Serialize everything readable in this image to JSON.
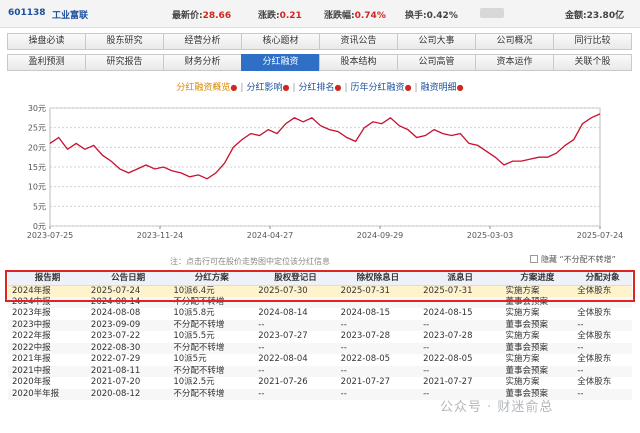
{
  "quote": {
    "code": "601138",
    "name": "工业富联",
    "latest_label": "最新价:",
    "latest_value": "28.66",
    "change_label": "涨跌:",
    "change_value": "0.21",
    "pct_label": "涨跌幅:",
    "pct_value": "0.74%",
    "turnover_label": "换手:",
    "turnover_value": "0.42%",
    "amount_label": "金额:",
    "amount_value": "23.80亿"
  },
  "nav_row1": [
    "操盘必读",
    "股东研究",
    "经营分析",
    "核心题材",
    "资讯公告",
    "公司大事",
    "公司概况",
    "同行比较"
  ],
  "nav_row2": [
    "盈利预测",
    "研究报告",
    "财务分析",
    "分红融资",
    "股本结构",
    "公司高管",
    "资本运作",
    "关联个股"
  ],
  "nav_active": "分红融资",
  "subtabs": [
    "分红融资概览",
    "分红影响",
    "分红排名",
    "历年分红融资",
    "融资明细"
  ],
  "chart_data": {
    "type": "line",
    "x_ticks": [
      "2023-07-25",
      "2023-11-24",
      "2024-04-27",
      "2024-09-29",
      "2025-03-03",
      "2025-07-24"
    ],
    "y_ticks": [
      "0元",
      "5元",
      "10元",
      "15元",
      "20元",
      "25元",
      "30元"
    ],
    "ylim": [
      0,
      30
    ],
    "series": [
      {
        "values": [
          21,
          22.5,
          19.5,
          21,
          19.5,
          20.5,
          18,
          16.5,
          14.5,
          13.5,
          14.5,
          15.5,
          14.5,
          15,
          14,
          13.5,
          12.5,
          13,
          12,
          13.5,
          16,
          20,
          22,
          23.5,
          23,
          24.5,
          23.5,
          26,
          27.5,
          26.5,
          27.5,
          25.5,
          24.5,
          24,
          22.5,
          21.5,
          25,
          26.5,
          26,
          27.5,
          25.5,
          24.5,
          22.5,
          23,
          24.5,
          23.5,
          23,
          23.5,
          21,
          20.5,
          19,
          17.5,
          15.5,
          16.5,
          16.5,
          17,
          17.5,
          17.5,
          18.5,
          20.5,
          22,
          26,
          27.5,
          28.5
        ]
      }
    ]
  },
  "hint": "注：点击行可在股价走势图中定位该分红信息",
  "hide_option": "隐藏 “不分配不转增”",
  "table": {
    "headers": [
      "报告期",
      "公告日期",
      "分红方案",
      "股权登记日",
      "除权除息日",
      "派息日",
      "方案进度",
      "分配对象"
    ],
    "rows": [
      [
        "2024年报",
        "2025-07-24",
        "10派6.4元",
        "2025-07-30",
        "2025-07-31",
        "2025-07-31",
        "实施方案",
        "全体股东"
      ],
      [
        "2024中报",
        "2024-08-14",
        "不分配不转增",
        "",
        "",
        "",
        "董事会预案",
        ""
      ],
      [
        "2023年报",
        "2024-08-08",
        "10派5.8元",
        "2024-08-14",
        "2024-08-15",
        "2024-08-15",
        "实施方案",
        "全体股东"
      ],
      [
        "2023中报",
        "2023-09-09",
        "不分配不转增",
        "--",
        "--",
        "--",
        "董事会预案",
        "--"
      ],
      [
        "2022年报",
        "2023-07-22",
        "10派5.5元",
        "2023-07-27",
        "2023-07-28",
        "2023-07-28",
        "实施方案",
        "全体股东"
      ],
      [
        "2022中报",
        "2022-08-30",
        "不分配不转增",
        "--",
        "--",
        "--",
        "董事会预案",
        "--"
      ],
      [
        "2021年报",
        "2022-07-29",
        "10派5元",
        "2022-08-04",
        "2022-08-05",
        "2022-08-05",
        "实施方案",
        "全体股东"
      ],
      [
        "2021中报",
        "2021-08-11",
        "不分配不转增",
        "--",
        "--",
        "--",
        "董事会预案",
        "--"
      ],
      [
        "2020年报",
        "2021-07-20",
        "10派2.5元",
        "2021-07-26",
        "2021-07-27",
        "2021-07-27",
        "实施方案",
        "全体股东"
      ],
      [
        "2020半年报",
        "2020-08-12",
        "不分配不转增",
        "--",
        "--",
        "--",
        "董事会预案",
        "--"
      ]
    ]
  },
  "watermark": "公众号 · 财迷俞总",
  "colors": {
    "line": "#c8102e",
    "active_tab": "#2f6fc6",
    "highlight_row": "#fff3cc",
    "red_box": "#e02424"
  }
}
